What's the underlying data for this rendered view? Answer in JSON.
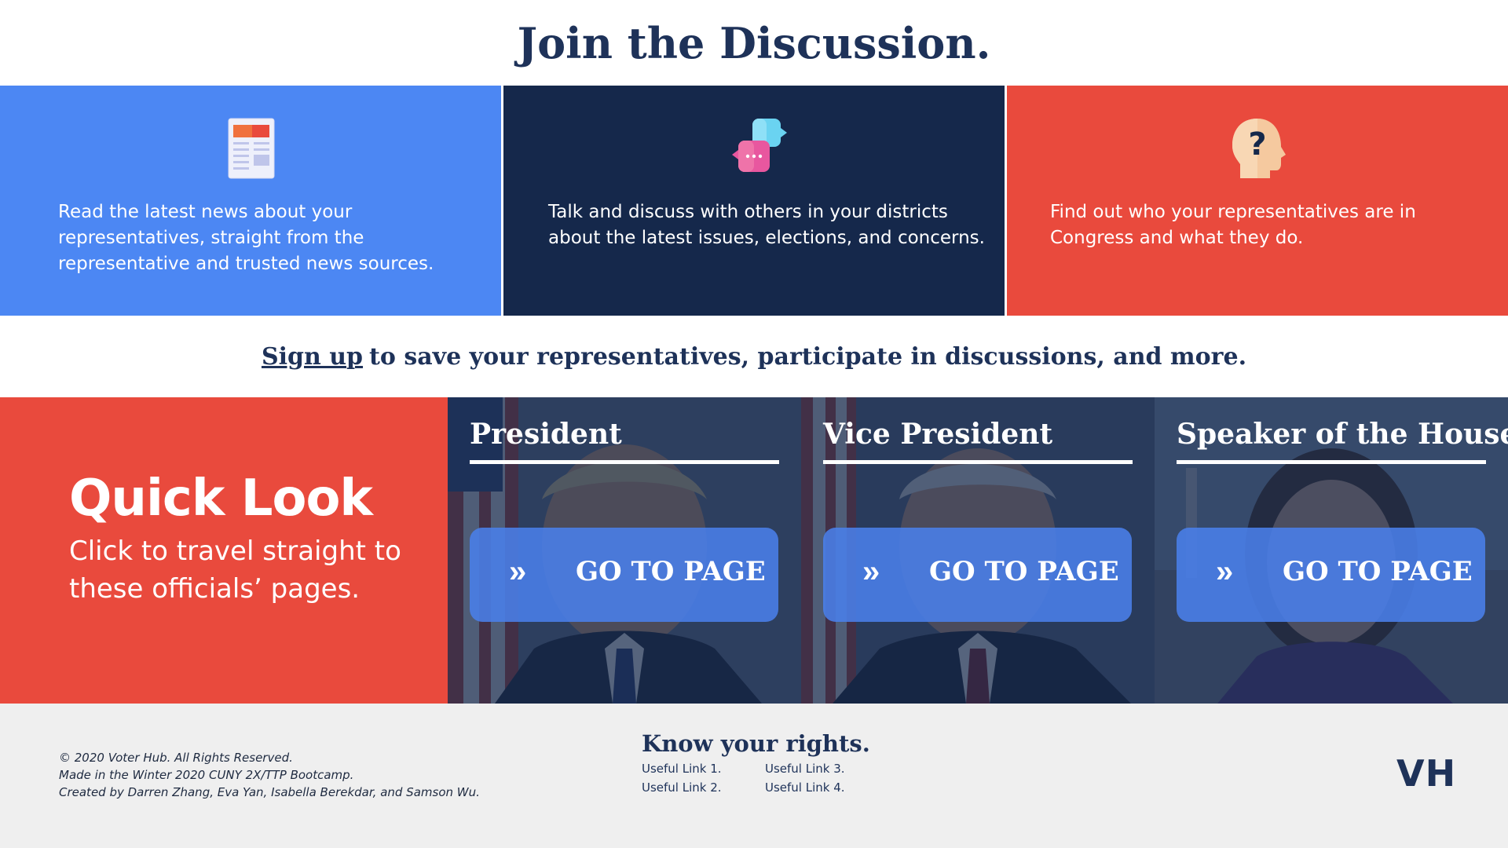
{
  "hero": {
    "title": "Join the Discussion."
  },
  "features": [
    {
      "icon": "newspaper-icon",
      "text": "Read the latest news about your representatives, straight from the representative and trusted news sources."
    },
    {
      "icon": "chat-bubbles-icon",
      "text": "Talk and discuss with others in your districts about the latest issues, elections, and concerns."
    },
    {
      "icon": "head-question-icon",
      "text": "Find out who your representatives are in Congress and what they do."
    }
  ],
  "signup": {
    "link": "Sign up",
    "text": "to save your representatives, participate in discussions, and more."
  },
  "quick_look": {
    "title": "Quick Look",
    "subtitle": "Click to travel straight to these officials’ pages.",
    "officials": [
      {
        "role": "President",
        "button_label": "GO TO PAGE",
        "chevron": "»"
      },
      {
        "role": "Vice President",
        "button_label": "GO TO PAGE",
        "chevron": "»"
      },
      {
        "role": "Speaker of the House",
        "button_label": "GO TO PAGE",
        "chevron": "»"
      }
    ]
  },
  "footer": {
    "credits": [
      "© 2020 Voter Hub. All Rights Reserved.",
      "Made in the Winter 2020 CUNY 2X/TTP Bootcamp.",
      "Created by Darren Zhang, Eva Yan, Isabella Berekdar, and Samson Wu."
    ],
    "rights_title": "Know your rights.",
    "links": [
      "Useful Link 1.",
      "Useful Link 3.",
      "Useful Link 2.",
      "Useful Link 4."
    ],
    "logo": "VH"
  },
  "colors": {
    "navy": "#15284b",
    "blue": "#4c87f3",
    "red": "#e94a3d",
    "heading": "#1e3259",
    "footer_bg": "#efefef"
  }
}
